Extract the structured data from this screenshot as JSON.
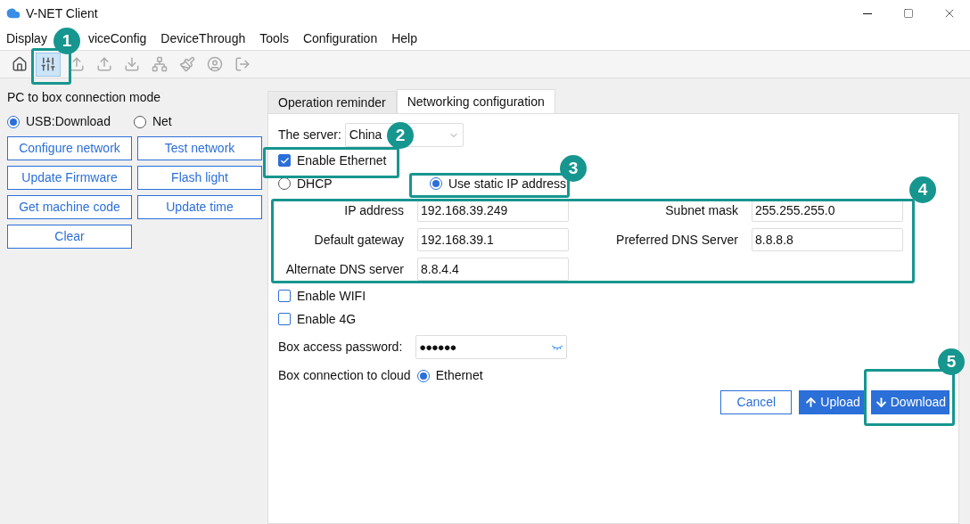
{
  "window": {
    "title": "V-NET Client"
  },
  "menu": [
    "Display",
    "viceConfig",
    "DeviceThrough",
    "Tools",
    "Configuration",
    "Help"
  ],
  "toolbar": [
    {
      "kind": "home",
      "selected": false,
      "disabled": false
    },
    {
      "kind": "sliders",
      "selected": true,
      "disabled": false
    },
    {
      "kind": "upload",
      "selected": false,
      "disabled": true
    },
    {
      "kind": "upload",
      "selected": false,
      "disabled": true
    },
    {
      "kind": "download",
      "selected": false,
      "disabled": true
    },
    {
      "kind": "network",
      "selected": false,
      "disabled": true
    },
    {
      "kind": "broom",
      "selected": false,
      "disabled": true
    },
    {
      "kind": "user",
      "selected": false,
      "disabled": true
    },
    {
      "kind": "exit",
      "selected": false,
      "disabled": true
    }
  ],
  "left": {
    "title": "PC to box connection mode",
    "modes": [
      {
        "label": "USB:Download",
        "selected": true
      },
      {
        "label": "Net",
        "selected": false
      }
    ],
    "buttons": [
      "Configure network",
      "Test network",
      "Update Firmware",
      "Flash light",
      "Get machine code",
      "Update time",
      "Clear"
    ]
  },
  "tabs": [
    {
      "label": "Operation reminder",
      "selected": false
    },
    {
      "label": "Networking configuration",
      "selected": true
    }
  ],
  "form": {
    "server_label": "The server:",
    "server_value": "China",
    "enable_ethernet": {
      "label": "Enable Ethernet",
      "checked": true
    },
    "ip_modes": [
      {
        "label": "DHCP",
        "selected": false
      },
      {
        "label": "Use static IP address",
        "selected": true
      }
    ],
    "fields": [
      {
        "label": "IP address",
        "value": "192.168.39.249"
      },
      {
        "label": "Subnet mask",
        "value": "255.255.255.0"
      },
      {
        "label": "Default gateway",
        "value": "192.168.39.1"
      },
      {
        "label": "Preferred DNS Server",
        "value": "8.8.8.8"
      },
      {
        "label": "Alternate DNS server",
        "value": "8.8.4.4"
      }
    ],
    "options": [
      {
        "label": "Enable WIFI",
        "checked": false
      },
      {
        "label": "Enable 4G",
        "checked": false
      }
    ],
    "password_label": "Box access password:",
    "password_value": "●●●●●●",
    "cloud_label": "Box connection to cloud",
    "cloud_option": {
      "label": "Ethernet",
      "selected": true
    },
    "buttons": [
      {
        "kind": "cancel",
        "label": "Cancel"
      },
      {
        "kind": "upload",
        "label": "Upload"
      },
      {
        "kind": "download",
        "label": "Download"
      }
    ]
  },
  "callouts": [
    "1",
    "2",
    "3",
    "4",
    "5"
  ]
}
